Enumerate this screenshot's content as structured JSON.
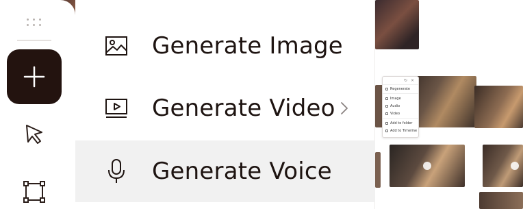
{
  "toolbar": {
    "tools": [
      {
        "name": "add",
        "icon": "plus-icon"
      },
      {
        "name": "select",
        "icon": "cursor-icon"
      },
      {
        "name": "frame",
        "icon": "frame-icon"
      }
    ],
    "accent_color": "#23130f"
  },
  "menu": {
    "items": [
      {
        "label": "Generate Image",
        "icon": "image-icon",
        "has_submenu": false,
        "active": false
      },
      {
        "label": "Generate Video",
        "icon": "video-icon",
        "has_submenu": true,
        "active": false
      },
      {
        "label": "Generate Voice",
        "icon": "microphone-icon",
        "has_submenu": false,
        "active": true
      }
    ]
  },
  "canvas": {
    "context_menu": {
      "items": [
        "Regenerate",
        "Image",
        "Audio",
        "Video",
        "Add to folder",
        "Add to Timeline"
      ]
    }
  }
}
